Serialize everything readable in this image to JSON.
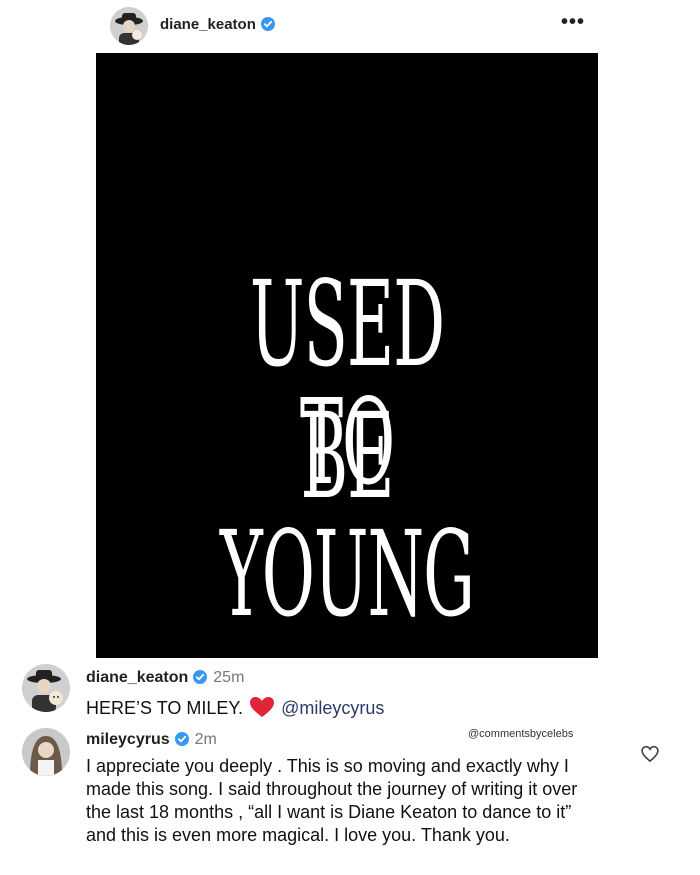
{
  "post": {
    "username": "diane_keaton",
    "more_icon": "more-options-icon",
    "image_text": {
      "line1": "USED TO",
      "line2": "BE YOUNG"
    }
  },
  "comments": [
    {
      "username": "diane_keaton",
      "time": "25m",
      "text_prefix": "HERE’S TO MILEY.",
      "emoji": "heart-emoji",
      "mention": "@mileycyrus"
    },
    {
      "username": "mileycyrus",
      "time": "2m",
      "text": "I appreciate you deeply . This is so moving and exactly why I made this song. I said throughout the journey of writing it over the last 18 months , “all I want is Diane Keaton to dance to it” and this is even more magical. I love you. Thank you."
    }
  ],
  "watermark": "@commentsbycelebs",
  "colors": {
    "verified": "#3897f0",
    "heart": "#e0243a",
    "mention": "#2b3a67",
    "post_bg": "#000000"
  }
}
